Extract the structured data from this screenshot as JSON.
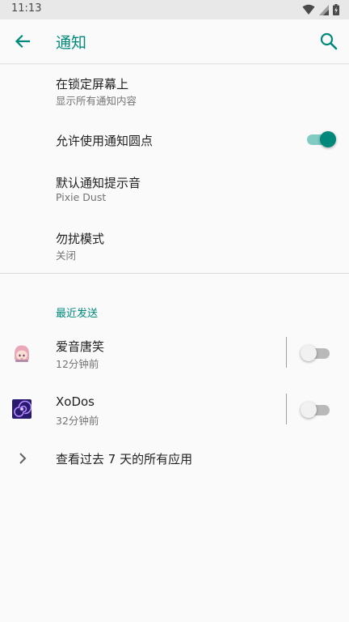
{
  "status_bar": {
    "time": "11:13",
    "icons": [
      "wifi-icon",
      "signal-icon",
      "battery-icon"
    ]
  },
  "app_bar": {
    "title": "通知",
    "back_icon": "arrow-back-icon",
    "search_icon": "search-icon"
  },
  "settings": {
    "lock_screen": {
      "title": "在锁定屏幕上",
      "summary": "显示所有通知内容"
    },
    "notification_dots": {
      "title": "允许使用通知圆点",
      "enabled": true
    },
    "default_sound": {
      "title": "默认通知提示音",
      "summary": "Pixie Dust"
    },
    "do_not_disturb": {
      "title": "勿扰模式",
      "summary": "关闭"
    }
  },
  "recent": {
    "header": "最近发送",
    "apps": [
      {
        "name": "爱音唐笑",
        "time": "12分钟前",
        "enabled": false,
        "icon": "anime-avatar-icon"
      },
      {
        "name": "XoDos",
        "time": "32分钟前",
        "enabled": false,
        "icon": "spiral-galaxy-icon"
      }
    ],
    "see_all": "查看过去 7 天的所有应用"
  },
  "colors": {
    "accent": "#00897b",
    "accent_light": "#80cbc4",
    "background": "#fafafa",
    "status_bar": "#e8e8e8"
  }
}
